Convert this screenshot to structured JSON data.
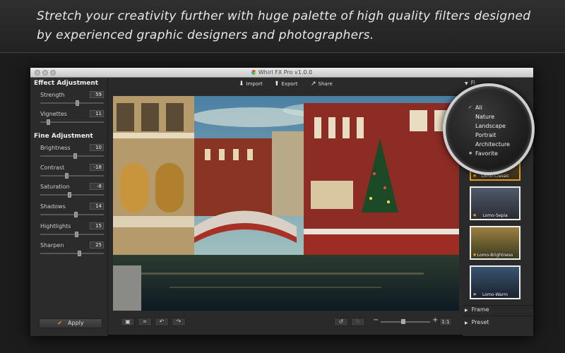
{
  "banner": {
    "line1": "Stretch your creativity further with huge palette of high quality filters designed",
    "line2": "by experienced graphic designers and photographers."
  },
  "window": {
    "title": "Whirl FX Pro v1.0.0"
  },
  "toolbar": {
    "import_label": "Import",
    "export_label": "Export",
    "share_label": "Share"
  },
  "effect_adjustment": {
    "title": "Effect Adjustment",
    "sliders": [
      {
        "label": "Strength",
        "value": "59",
        "level": 0.59
      },
      {
        "label": "Vignettes",
        "value": "11",
        "level": 0.11
      }
    ]
  },
  "fine_adjustment": {
    "title": "Fine Adjustment",
    "sliders": [
      {
        "label": "Brightness",
        "value": "10",
        "level": 0.55
      },
      {
        "label": "Contrast",
        "value": "-18",
        "level": 0.41
      },
      {
        "label": "Saturation",
        "value": "-8",
        "level": 0.46
      },
      {
        "label": "Shadows",
        "value": "14",
        "level": 0.57
      },
      {
        "label": "Hightlights",
        "value": "15",
        "level": 0.58
      },
      {
        "label": "Sharpen",
        "value": "25",
        "level": 0.62
      }
    ]
  },
  "apply": {
    "label": "Apply"
  },
  "right_panel": {
    "filter_header": "Fi",
    "category_menu": [
      "All",
      "Nature",
      "Landscape",
      "Portrait",
      "Architecture",
      "Favorite"
    ],
    "checked_category": "All",
    "thumbnails": [
      {
        "label": "Lomo-Classic",
        "favorite": true,
        "selected": true
      },
      {
        "label": "Lomo-Sepia",
        "favorite": true,
        "selected": false
      },
      {
        "label": "Lomo-Brightness",
        "favorite": true,
        "selected": false
      },
      {
        "label": "Lomo-Warm",
        "favorite": false,
        "selected": false
      }
    ],
    "frame_label": "Frame",
    "preset_label": "Preset"
  },
  "zoom": {
    "minus": "−",
    "plus": "+",
    "ratio": "1:1",
    "level": 0.45
  }
}
